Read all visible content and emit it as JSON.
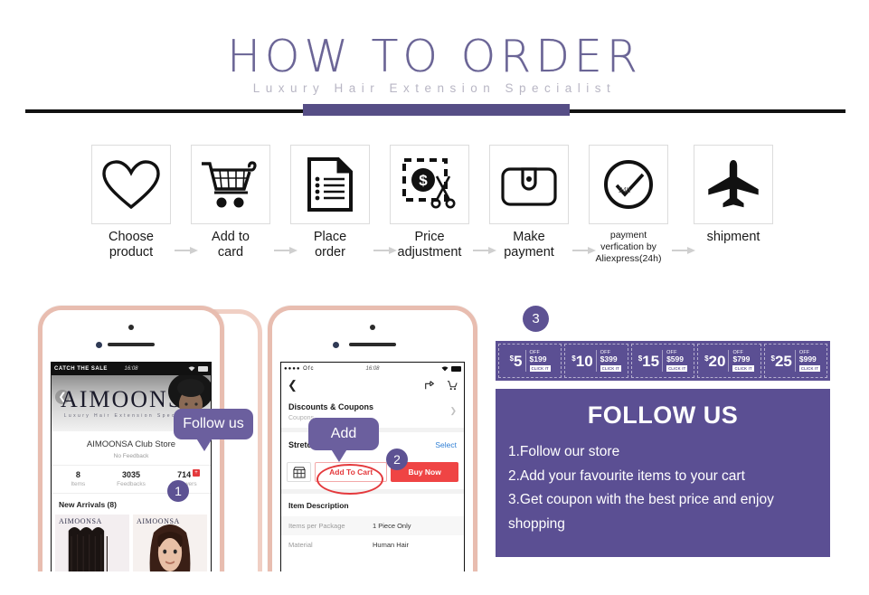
{
  "header": {
    "title": "HOW TO ORDER",
    "subtitle": "Luxury Hair Extension Specialist"
  },
  "steps": [
    {
      "icon": "heart-icon",
      "label_line1": "Choose",
      "label_line2": "product",
      "small": false
    },
    {
      "icon": "cart-icon",
      "label_line1": "Add to",
      "label_line2": "card",
      "small": false
    },
    {
      "icon": "document-icon",
      "label_line1": "Place",
      "label_line2": "order",
      "small": false
    },
    {
      "icon": "price-cut-icon",
      "label_line1": "Price",
      "label_line2": "adjustment",
      "small": false
    },
    {
      "icon": "wallet-icon",
      "label_line1": "Make",
      "label_line2": "payment",
      "small": false
    },
    {
      "icon": "clock-check-icon",
      "label_line1": "payment",
      "label_line2": "verfication by",
      "label_line3": "Aliexpress(24h)",
      "small": true
    },
    {
      "icon": "airplane-icon",
      "label_line1": "shipment",
      "label_line2": "",
      "small": false
    }
  ],
  "phone1": {
    "statusbar": {
      "carrier": "CATCH THE SALE",
      "time": "16:08",
      "wifi": "wifi-icon",
      "battery": "battery-icon"
    },
    "banner": {
      "logo": "AIMOONSA",
      "tagline": "Luxury Hair Extension Specialist",
      "back": "back-chevron-icon"
    },
    "store_name": "AIMOONSA Club Store",
    "feedback": "No Feedback",
    "stats": [
      {
        "num": "8",
        "label": "Items"
      },
      {
        "num": "3035",
        "label": "Feedbacks"
      },
      {
        "num": "714",
        "label": "Followers",
        "badge": "+"
      }
    ],
    "arrivals": "New Arrivals (8)",
    "thumbs": [
      {
        "watermark": "AIMOONSA"
      },
      {
        "watermark": "AIMOONSA"
      }
    ],
    "bubble": "Follow us",
    "badge": "1"
  },
  "phone2": {
    "statusbar": {
      "carrier": "Ofc",
      "time": "16:08",
      "wifi": "wifi-icon",
      "battery": "battery-icon"
    },
    "nav": {
      "back": "back-chevron-icon",
      "share": "share-icon",
      "cart": "cart-icon"
    },
    "coupon_row": {
      "title": "Discounts & Coupons",
      "sub": "Coupons",
      "chevron": "chevron-right-icon"
    },
    "length_row": {
      "title": "Stretched Length",
      "action": "Select"
    },
    "buttons": {
      "store": "store-icon",
      "add_to_cart": "Add To Cart",
      "buy_now": "Buy Now"
    },
    "description_title": "Item Description",
    "description_rows": [
      {
        "key": "Items per Package",
        "value": "1 Piece Only"
      },
      {
        "key": "Material",
        "value": "Human Hair"
      }
    ],
    "bubble": "Add",
    "badge": "2"
  },
  "right_panel": {
    "badge": "3",
    "coupons": [
      {
        "amount": "5",
        "currency": "$",
        "off": "OFF",
        "min": "$199",
        "cta": "CLICK IT"
      },
      {
        "amount": "10",
        "currency": "$",
        "off": "OFF",
        "min": "$399",
        "cta": "CLICK IT"
      },
      {
        "amount": "15",
        "currency": "$",
        "off": "OFF",
        "min": "$599",
        "cta": "CLICK IT"
      },
      {
        "amount": "20",
        "currency": "$",
        "off": "OFF",
        "min": "$799",
        "cta": "CLICK IT"
      },
      {
        "amount": "25",
        "currency": "$",
        "off": "OFF",
        "min": "$999",
        "cta": "CLICK IT"
      }
    ],
    "follow_title": "FOLLOW US",
    "follow_items": [
      "1.Follow our store",
      "2.Add your favourite items to your cart",
      "3.Get coupon with the best price and enjoy",
      "shopping"
    ]
  },
  "colors": {
    "purple": "#5b4f93",
    "purple_dark": "#564e86",
    "purple_title": "#6b6596",
    "rose_gold": "#e8bdb0",
    "red": "#e4393c",
    "rule": "#111111"
  }
}
